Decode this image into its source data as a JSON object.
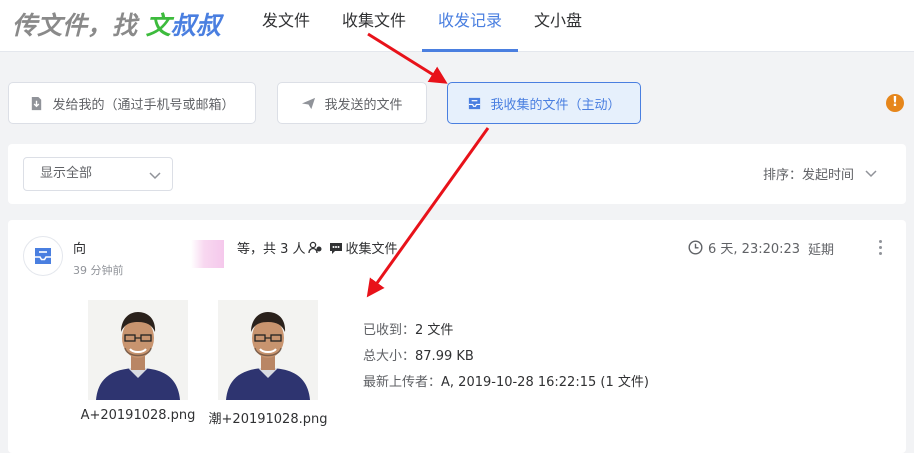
{
  "logo": {
    "part1": "传文件，找 ",
    "part2": "文",
    "part3": "叔叔"
  },
  "nav": [
    {
      "label": "发文件"
    },
    {
      "label": "收集文件"
    },
    {
      "label": "收发记录"
    },
    {
      "label": "文小盘"
    }
  ],
  "filters": {
    "sent_to_me": "发给我的（通过手机号或邮箱）",
    "i_sent": "我发送的文件",
    "i_collected": "我收集的文件（主动）"
  },
  "select": {
    "value": "显示全部"
  },
  "sort": {
    "label": "排序：发起时间"
  },
  "card": {
    "to": "向",
    "summary_prefix": "等，共 3 人",
    "summary_suffix": "收集文件",
    "ago": "39 分钟前",
    "deadline": "6 天, 23:20:23",
    "extend": "延期",
    "files": [
      {
        "name": "A+20191028.png"
      },
      {
        "name": "潮+20191028.png"
      }
    ],
    "received_label": "已收到：",
    "received_value": "2 文件",
    "size_label": "总大小：",
    "size_value": "87.99 KB",
    "latest_label": "最新上传者：",
    "latest_value": "A, 2019-10-28 16:22:15 (1 文件)"
  },
  "colors": {
    "accent": "#4a7fe0",
    "arrow": "#e8121a",
    "warning": "#e6861b"
  }
}
